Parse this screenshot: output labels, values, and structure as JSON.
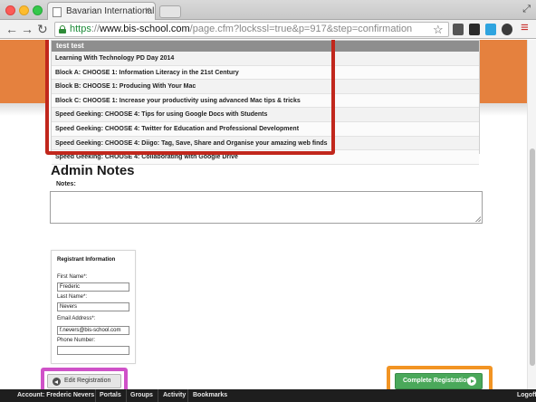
{
  "browser": {
    "tab_title": "Bavarian International Scho",
    "tab_close": "×",
    "url_scheme": "https",
    "url_separator": "://",
    "url_host": "www.bis-school.com",
    "url_path": "/page.cfm?lockssl=true&p=917&step=confirmation",
    "back_icon": "←",
    "forward_icon": "→",
    "reload_icon": "↻",
    "star_icon": "☆",
    "menu_icon": "≡"
  },
  "sessions": {
    "header": "test test",
    "rows": [
      "Learning With Technology PD Day 2014",
      "Block A: CHOOSE 1: Information Literacy in the 21st Century",
      "Block B: CHOOSE 1: Producing With Your Mac",
      "Block C: CHOOSE 1: Increase your productivity using advanced Mac tips & tricks",
      "Speed Geeking: CHOOSE 4: Tips for using Google Docs with Students",
      "Speed Geeking: CHOOSE 4: Twitter for Education and Professional Development",
      "Speed Geeking: CHOOSE 4: Diigo: Tag, Save, Share and Organise your amazing web finds",
      "Speed Geeking: CHOOSE 4: Collaborating with Google Drive"
    ]
  },
  "admin": {
    "title": "Admin Notes",
    "notes_label": "Notes:",
    "notes_value": ""
  },
  "registrant": {
    "title": "Registrant Information",
    "first_name_label": "First Name*:",
    "first_name_value": "Frederic",
    "last_name_label": "Last Name*:",
    "last_name_value": "Nevers",
    "email_label": "Email Address*:",
    "email_value": "f.nevers@bis-school.com",
    "phone_label": "Phone Number:",
    "phone_value": ""
  },
  "buttons": {
    "edit": "Edit Registration",
    "complete": "Complete Registration"
  },
  "bottombar": {
    "account": "Account: Frederic Nevers",
    "portals": "Portals",
    "groups": "Groups",
    "activity": "Activity",
    "bookmarks": "Bookmarks",
    "logoff": "Logoff"
  },
  "colors": {
    "highlight_red": "#c1271c",
    "highlight_pink": "#cf52c8",
    "highlight_orange": "#f29423",
    "brand_orange": "#e5813e",
    "complete_green": "#4aa85a"
  }
}
